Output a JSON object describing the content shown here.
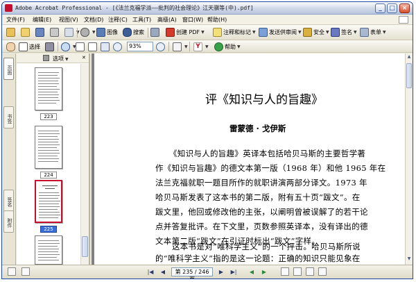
{
  "window": {
    "title": "Adobe Acrobat Professional - [《法兰克福学派——批判的社会理论》江天骥等(中).pdf]",
    "minimize": "_",
    "maximize": "□",
    "close": "×"
  },
  "menu": [
    "文件(F)",
    "编辑(E)",
    "视图(V)",
    "文档(D)",
    "注释(C)",
    "工具(T)",
    "高级(A)",
    "窗口(W)",
    "帮助(H)"
  ],
  "toolbar1": {
    "scan_label": "图像",
    "save_doc_label": "搜索",
    "create_pdf": "创建 PDF",
    "comment_markup": "注释和标记",
    "send_review": "发送供审阅",
    "secure": "安全",
    "sign": "签名",
    "forms": "表单"
  },
  "toolbar2": {
    "select_label": "选择",
    "zoom_value": "93%",
    "help_label": "帮助"
  },
  "pages_panel": {
    "options_label": "选项",
    "thumbnails": [
      {
        "label": "223"
      },
      {
        "label": "224"
      },
      {
        "label": "225"
      }
    ]
  },
  "side_tabs": [
    "页面",
    "书签",
    "签名",
    "附件"
  ],
  "document": {
    "title": "评《知识与人的旨趣》",
    "author": "雷蒙德 · 戈伊斯",
    "paragraph1": [
      "《知识与人的旨趣》英译本包括哈贝马斯的主要哲学著",
      "作《知识与旨趣》的德文本第一版（1968 年）和他 1965 年在",
      "法兰克福就职一题目所作的就职讲演两部分译文。1973 年",
      "哈贝马斯发表了这本书的第二版，附有五十页“跋文”。在",
      "跋文里，他回或修改他的主张，以阐明曾被误解了的若干论",
      "点并答复批评。在下文里，页数参照英译本，没有译出的德",
      "文本第二版“跋文”在引证时标出“跋文”字样。"
    ],
    "paragraph2": [
      "这本书是对“唯科学主义”的一个抨击。哈贝马斯所说",
      "的“唯科学主义”指的是这一论题：正确的知识只能见象在"
    ]
  },
  "status": {
    "page_indicator": "第 235 / 246 页"
  }
}
